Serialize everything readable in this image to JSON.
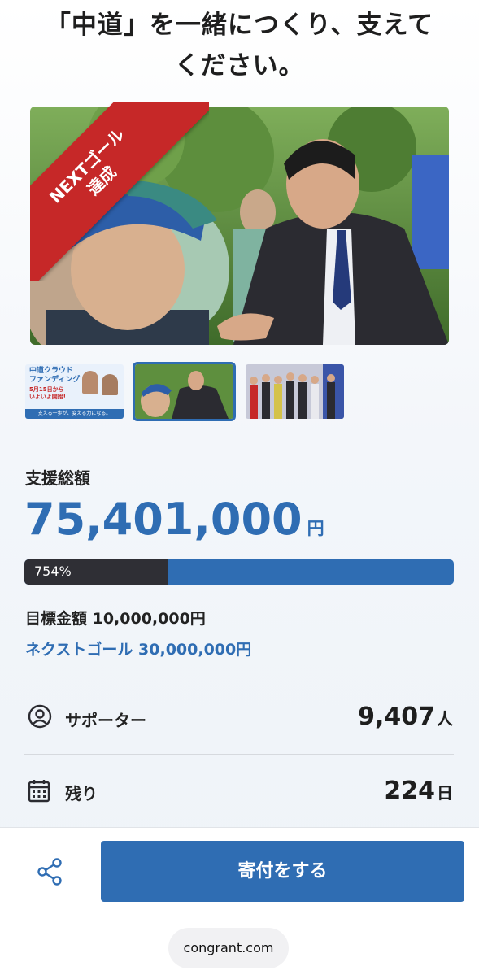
{
  "header": {
    "title_line1": "「中道」を一緒につくり、支えて",
    "title_line2": "ください。"
  },
  "hero": {
    "ribbon_line1": "NEXTゴール",
    "ribbon_line2": "達成",
    "ribbon_color": "#c62828"
  },
  "thumbnails": {
    "thumb1": {
      "heading1": "中道クラウド",
      "heading2": "ファンディング",
      "date": "5月15日から",
      "date2": "いよいよ開始!",
      "footer": "支える一歩が、変える力になる。"
    }
  },
  "funding": {
    "total_label": "支援総額",
    "amount": "75,401,000",
    "currency": "円",
    "progress_label": "754%",
    "progress_percent": 754,
    "goal": "目標金額 10,000,000円",
    "next_goal": "ネクストゴール 30,000,000円"
  },
  "stats": {
    "supporters_label": "サポーター",
    "supporters_value": "9,407",
    "supporters_unit": "人",
    "remaining_label": "残り",
    "remaining_value": "224",
    "remaining_unit": "日"
  },
  "footer": {
    "donate_label": "寄付をする",
    "domain": "congrant.com"
  },
  "colors": {
    "accent": "#2f6db3",
    "progress_dark": "#2f2f35"
  },
  "icons": {
    "share": "share-icon",
    "supporter": "user-circle-icon",
    "calendar": "calendar-icon"
  }
}
